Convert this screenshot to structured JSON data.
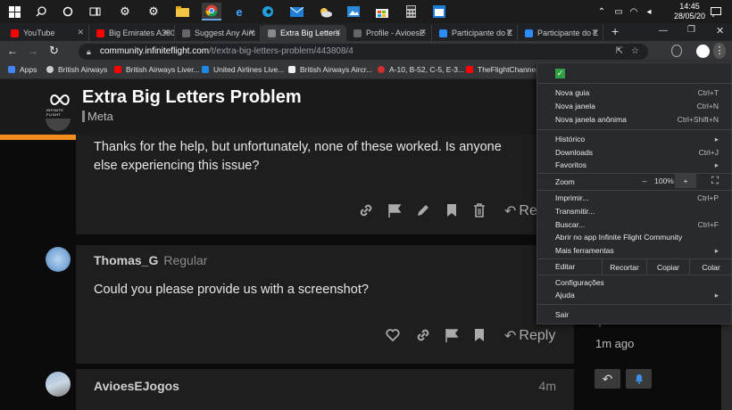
{
  "taskbar": {
    "time": "14:45",
    "date": "28/05/20",
    "icons": [
      "windows-icon",
      "search-icon",
      "cortana-icon",
      "task-view-icon",
      "settings-icon",
      "gear-icon",
      "file-explorer-icon",
      "chrome-icon",
      "edge-icon",
      "edge-new-icon",
      "mail-icon",
      "weather-icon",
      "photos-icon",
      "store-icon",
      "calculator-icon",
      "calendar-icon"
    ]
  },
  "tabs": [
    {
      "title": "YouTube",
      "favicon_color": "#ff0000"
    },
    {
      "title": "Big Emirates A380",
      "favicon_color": "#ff0000"
    },
    {
      "title": "Suggest Any Airc",
      "favicon_color": "#888888"
    },
    {
      "title": "Extra Big Letters",
      "favicon_color": "#888888"
    },
    {
      "title": "Profile - AvioesE",
      "favicon_color": "#888888"
    },
    {
      "title": "Participante do Z",
      "favicon_color": "#2d8cff"
    },
    {
      "title": "Participante do Z",
      "favicon_color": "#2d8cff"
    }
  ],
  "omnibox": {
    "domain": "community.infiniteflight.com",
    "path": "/t/extra-big-letters-problem/443808/4"
  },
  "bookmarks": [
    {
      "label": "Apps",
      "color": "#4285f4"
    },
    {
      "label": "British Airways",
      "color": "#cccccc"
    },
    {
      "label": "British Airways Liver...",
      "color": "#ff0000"
    },
    {
      "label": "United Airlines Live...",
      "color": "#1e88e5"
    },
    {
      "label": "British Airways Aircr...",
      "color": "#f0f0f0"
    },
    {
      "label": "A-10, B-52, C-5, E-3...",
      "color": "#d32f2f"
    },
    {
      "label": "TheFlightChannel...",
      "color": "#ff0000"
    }
  ],
  "site": {
    "logo_text": "INFINITE FLIGHT",
    "topic_title": "Extra Big Letters Problem",
    "category": "Meta"
  },
  "posts": [
    {
      "text": "Thanks for the help, but unfortunately, none of these worked. Is anyone else experiencing this issue?",
      "reply_label": "Re"
    },
    {
      "author": "Thomas_G",
      "author_title": "Regular",
      "text": "Could you please provide us with a screenshot?",
      "reply_label": "Reply"
    },
    {
      "author": "AvioesEJogos",
      "time": "4m"
    }
  ],
  "timeline": {
    "label": "1m ago"
  },
  "menu": {
    "items": [
      {
        "label": "Nova guia",
        "shortcut": "Ctrl+T"
      },
      {
        "label": "Nova janela",
        "shortcut": "Ctrl+N"
      },
      {
        "label": "Nova janela anônima",
        "shortcut": "Ctrl+Shift+N"
      },
      {
        "label": "Histórico",
        "shortcut": ""
      },
      {
        "label": "Downloads",
        "shortcut": "Ctrl+J"
      },
      {
        "label": "Favoritos",
        "shortcut": ""
      },
      {
        "label": "Zoom",
        "shortcut": ""
      },
      {
        "label": "Imprimir...",
        "shortcut": "Ctrl+P"
      },
      {
        "label": "Transmitir...",
        "shortcut": ""
      },
      {
        "label": "Buscar...",
        "shortcut": "Ctrl+F"
      },
      {
        "label": "Abrir no app Infinite Flight Community",
        "shortcut": ""
      },
      {
        "label": "Mais ferramentas",
        "shortcut": ""
      },
      {
        "label": "Editar",
        "shortcut": ""
      },
      {
        "label": "Configurações",
        "shortcut": ""
      },
      {
        "label": "Ajuda",
        "shortcut": ""
      },
      {
        "label": "Sair",
        "shortcut": ""
      }
    ],
    "zoom": {
      "minus": "–",
      "value": "100%",
      "plus": "+"
    },
    "edit": {
      "cut": "Recortar",
      "copy": "Copiar",
      "paste": "Colar"
    }
  },
  "colors": {
    "accent": "#f28c1e",
    "menu_bg": "#292a2d",
    "card_bg": "#1e1e1e"
  }
}
